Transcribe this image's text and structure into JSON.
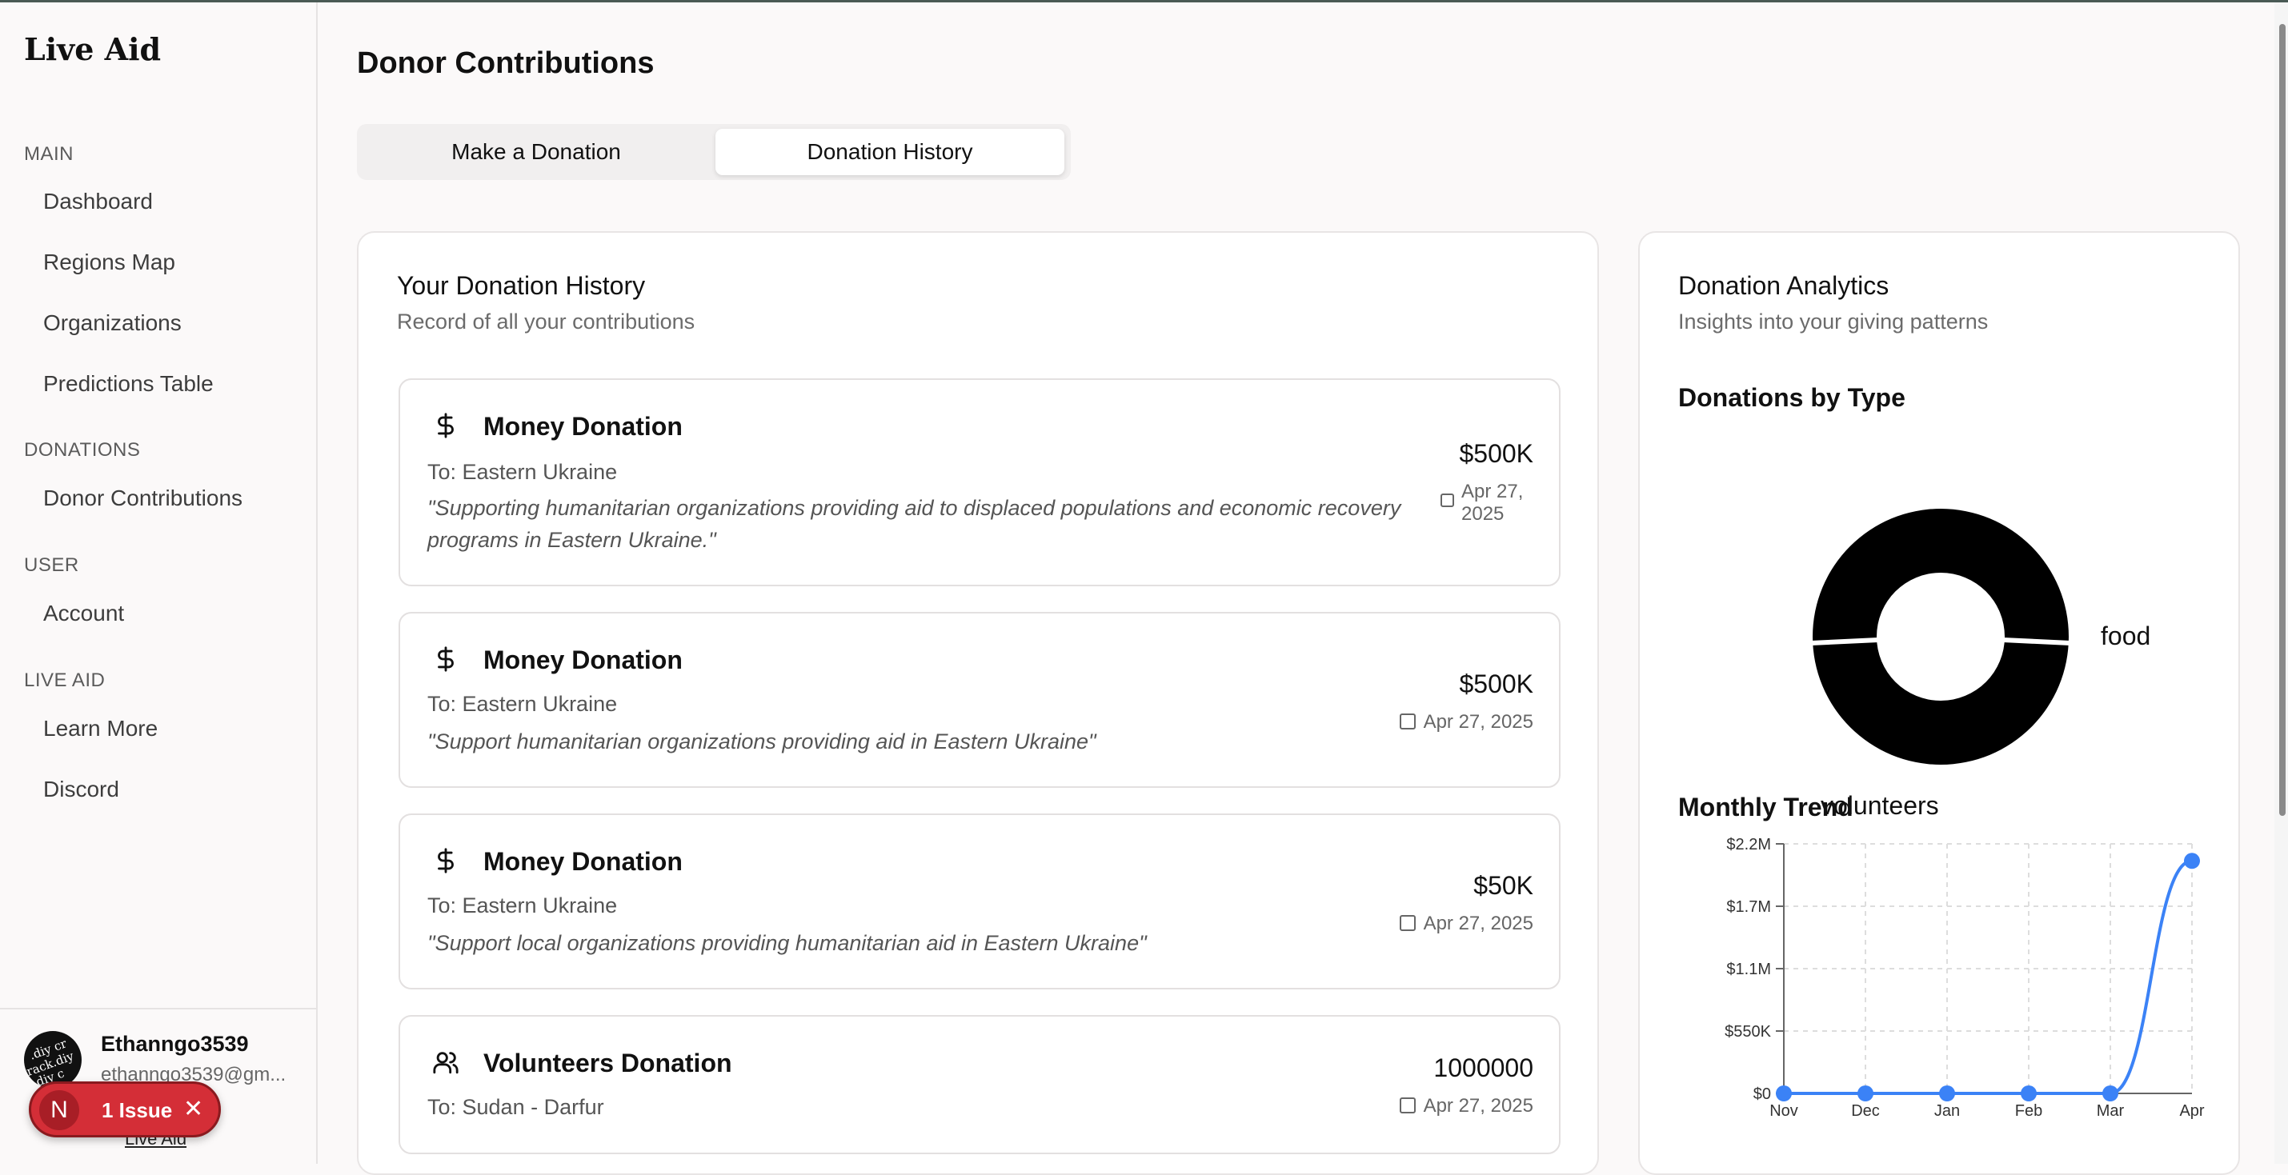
{
  "app": {
    "brand": "Live Aid"
  },
  "sidebar": {
    "sections": [
      {
        "label": "MAIN",
        "items": [
          "Dashboard",
          "Regions Map",
          "Organizations",
          "Predictions Table"
        ]
      },
      {
        "label": "DONATIONS",
        "items": [
          "Donor Contributions"
        ]
      },
      {
        "label": "USER",
        "items": [
          "Account"
        ]
      },
      {
        "label": "LIVE AID",
        "items": [
          "Learn More",
          "Discord"
        ]
      }
    ],
    "user": {
      "name": "Ethanngo3539",
      "email": "ethanngo3539@gm..."
    },
    "footer_link": "Live Aid"
  },
  "issue_badge": {
    "letter": "N",
    "text": "1 Issue",
    "close": "✕"
  },
  "main": {
    "title": "Donor Contributions",
    "tabs": [
      {
        "label": "Make a Donation",
        "active": false
      },
      {
        "label": "Donation History",
        "active": true
      }
    ]
  },
  "history": {
    "title": "Your Donation History",
    "subtitle": "Record of all your contributions",
    "items": [
      {
        "type": "Money Donation",
        "icon": "dollar-icon",
        "to": "To: Eastern Ukraine",
        "message": "\"Supporting humanitarian organizations providing aid to displaced populations and economic recovery programs in Eastern Ukraine.\"",
        "amount": "$500K",
        "date_line1": "Apr 27,",
        "date_line2": "2025"
      },
      {
        "type": "Money Donation",
        "icon": "dollar-icon",
        "to": "To: Eastern Ukraine",
        "message": "\"Support humanitarian organizations providing aid in Eastern Ukraine\"",
        "amount": "$500K",
        "date": "Apr 27, 2025"
      },
      {
        "type": "Money Donation",
        "icon": "dollar-icon",
        "to": "To: Eastern Ukraine",
        "message": "\"Support local organizations providing humanitarian aid in Eastern Ukraine\"",
        "amount": "$50K",
        "date": "Apr 27, 2025"
      },
      {
        "type": "Volunteers Donation",
        "icon": "users-icon",
        "to": "To: Sudan - Darfur",
        "amount": "1000000",
        "date": "Apr 27, 2025"
      }
    ]
  },
  "analytics": {
    "title": "Donation Analytics",
    "subtitle": "Insights into your giving patterns",
    "by_type_title": "Donations by Type",
    "trend_title": "Monthly Trend"
  },
  "chart_data": [
    {
      "type": "pie",
      "title": "Donations by Type",
      "labels": [
        "food",
        "volunteers"
      ],
      "color": "#000000"
    },
    {
      "type": "line",
      "title": "Monthly Trend",
      "categories": [
        "Nov",
        "Dec",
        "Jan",
        "Feb",
        "Mar",
        "Apr"
      ],
      "values": [
        0,
        0,
        0,
        0,
        0,
        2050000
      ],
      "yticks": [
        "$0",
        "$550K",
        "$1.1M",
        "$1.7M",
        "$2.2M"
      ],
      "ylim": [
        0,
        2200000
      ],
      "grid": true,
      "color": "#3b82f6"
    }
  ]
}
